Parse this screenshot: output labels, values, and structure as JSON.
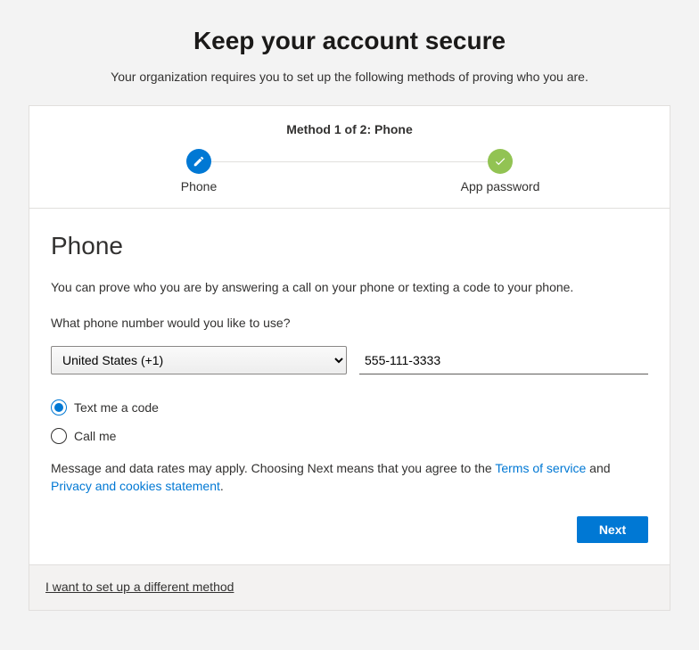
{
  "page": {
    "title": "Keep your account secure",
    "subtitle": "Your organization requires you to set up the following methods of proving who you are."
  },
  "stepper": {
    "method_label": "Method 1 of 2: Phone",
    "steps": [
      {
        "label": "Phone",
        "state": "current"
      },
      {
        "label": "App password",
        "state": "complete"
      }
    ]
  },
  "phone_section": {
    "heading": "Phone",
    "description": "You can prove who you are by answering a call on your phone or texting a code to your phone.",
    "prompt": "What phone number would you like to use?",
    "country_value": "United States (+1)",
    "phone_value": "555-111-3333",
    "radios": [
      {
        "label": "Text me a code",
        "selected": true
      },
      {
        "label": "Call me",
        "selected": false
      }
    ],
    "disclaimer_prefix": "Message and data rates may apply. Choosing Next means that you agree to the ",
    "tos_label": "Terms of service",
    "and_text": " and ",
    "privacy_label": "Privacy and cookies statement",
    "period": ".",
    "next_button": "Next"
  },
  "footer": {
    "different_method": "I want to set up a different method"
  }
}
